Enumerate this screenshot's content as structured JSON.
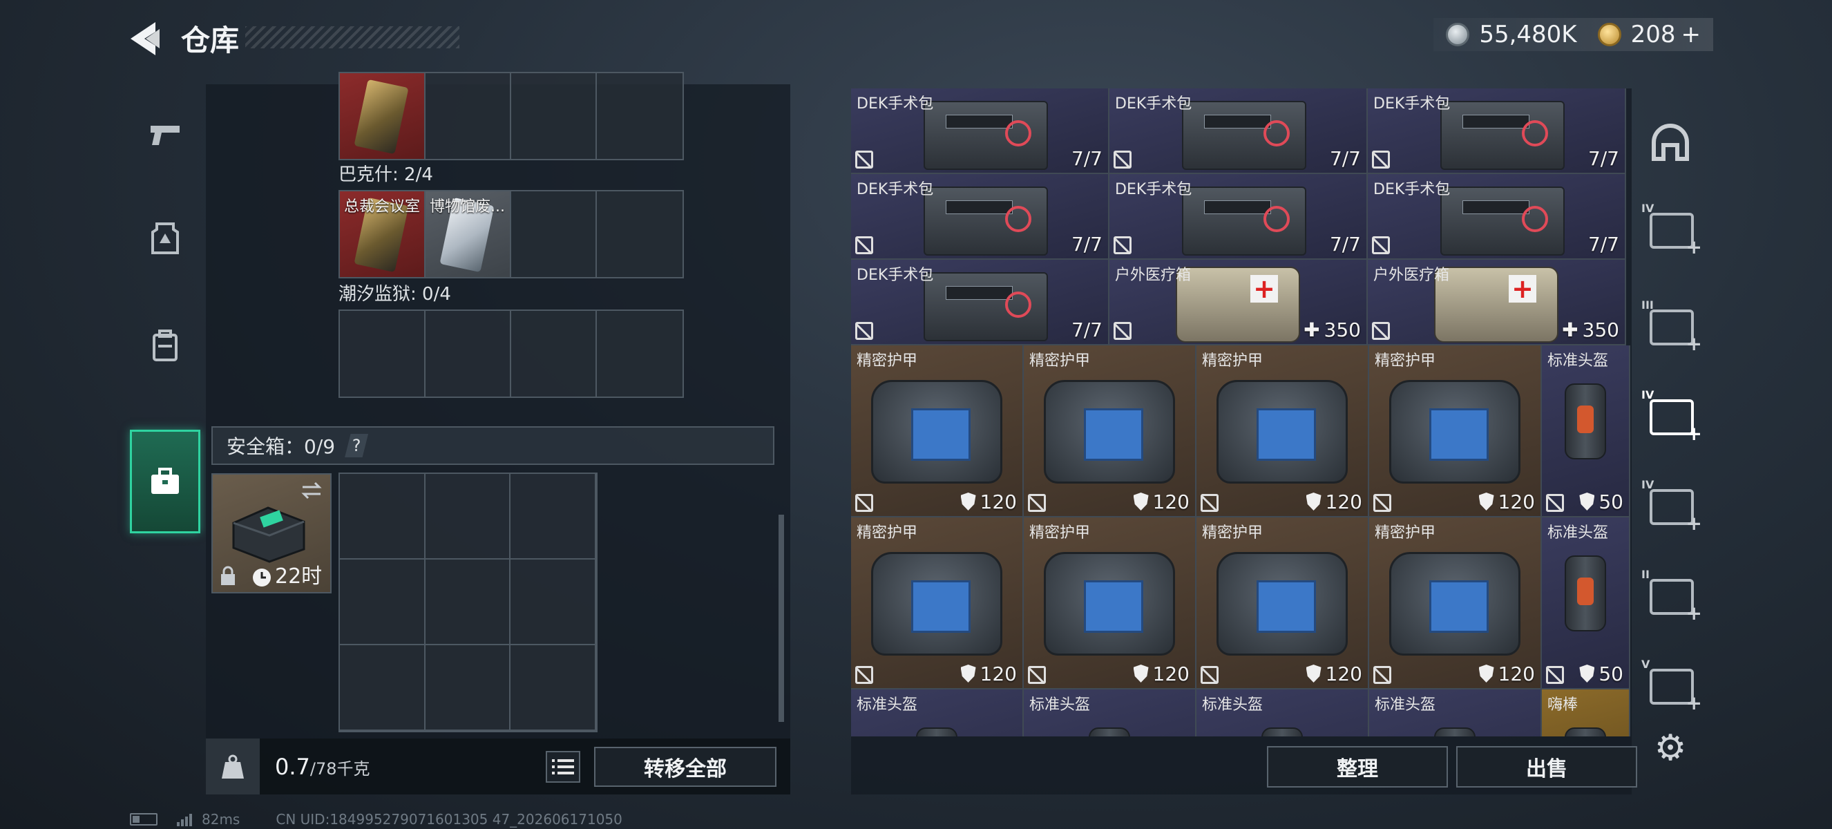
{
  "header": {
    "title": "仓库",
    "currency": {
      "silver_amount": "55,480K",
      "gold_amount": "208",
      "gold_plus": "+"
    }
  },
  "left_panel": {
    "groups": [
      {
        "label": "巴克什: 2/4"
      },
      {
        "label": "潮汐监狱: 0/4"
      }
    ],
    "top_row_cells": [
      {
        "label": "",
        "style": "red",
        "card": "gold"
      },
      {
        "label": ""
      },
      {
        "label": ""
      },
      {
        "label": ""
      }
    ],
    "bakshi_cells": [
      {
        "label": "总裁会议室",
        "style": "red",
        "card": "gold"
      },
      {
        "label": "博物馆废...",
        "style": "gray",
        "card": "silver"
      },
      {
        "label": ""
      },
      {
        "label": ""
      }
    ],
    "safebox": {
      "label": "安全箱：0/9",
      "help": "?",
      "item_timer": "22时"
    },
    "footer": {
      "weight_current": "0.7",
      "weight_max": "/78千克",
      "transfer_all": "转移全部"
    }
  },
  "right_panel": {
    "tiles": [
      {
        "name": "DEK手术包",
        "count": "7/7",
        "kind": "kit",
        "bg": "purple",
        "row": 0,
        "col": 0
      },
      {
        "name": "DEK手术包",
        "count": "7/7",
        "kind": "kit",
        "bg": "purple",
        "row": 0,
        "col": 1
      },
      {
        "name": "DEK手术包",
        "count": "7/7",
        "kind": "kit",
        "bg": "purple",
        "row": 0,
        "col": 2
      },
      {
        "name": "DEK手术包",
        "count": "7/7",
        "kind": "kit",
        "bg": "purple",
        "row": 1,
        "col": 0
      },
      {
        "name": "DEK手术包",
        "count": "7/7",
        "kind": "kit",
        "bg": "purple",
        "row": 1,
        "col": 1
      },
      {
        "name": "DEK手术包",
        "count": "7/7",
        "kind": "kit",
        "bg": "purple",
        "row": 1,
        "col": 2
      },
      {
        "name": "DEK手术包",
        "count": "7/7",
        "kind": "kit",
        "bg": "purple",
        "row": 2,
        "col": 0
      },
      {
        "name": "户外医疗箱",
        "count": "350",
        "kind": "medbox",
        "bg": "purple",
        "row": 2,
        "col": 1
      },
      {
        "name": "户外医疗箱",
        "count": "350",
        "kind": "medbox",
        "bg": "purple",
        "row": 2,
        "col": 2
      }
    ],
    "armor_tiles": [
      {
        "name": "精密护甲",
        "count": "120",
        "kind": "armor",
        "bg": "brown"
      },
      {
        "name": "精密护甲",
        "count": "120",
        "kind": "armor",
        "bg": "brown"
      },
      {
        "name": "精密护甲",
        "count": "120",
        "kind": "armor",
        "bg": "brown"
      },
      {
        "name": "精密护甲",
        "count": "120",
        "kind": "armor",
        "bg": "brown"
      },
      {
        "name": "标准头盔",
        "count": "50",
        "kind": "helmet",
        "bg": "purple"
      },
      {
        "name": "精密护甲",
        "count": "120",
        "kind": "armor",
        "bg": "brown"
      },
      {
        "name": "精密护甲",
        "count": "120",
        "kind": "armor",
        "bg": "brown"
      },
      {
        "name": "精密护甲",
        "count": "120",
        "kind": "armor",
        "bg": "brown"
      },
      {
        "name": "精密护甲",
        "count": "120",
        "kind": "armor",
        "bg": "brown"
      },
      {
        "name": "标准头盔",
        "count": "50",
        "kind": "helmet",
        "bg": "purple"
      },
      {
        "name": "标准头盔",
        "count": "",
        "kind": "helmet",
        "bg": "purple"
      },
      {
        "name": "标准头盔",
        "count": "",
        "kind": "helmet",
        "bg": "purple"
      },
      {
        "name": "标准头盔",
        "count": "",
        "kind": "helmet",
        "bg": "purple"
      },
      {
        "name": "标准头盔",
        "count": "",
        "kind": "helmet",
        "bg": "purple"
      },
      {
        "name": "嗨棒",
        "count": "",
        "kind": "other",
        "bg": "gold"
      }
    ],
    "footer": {
      "sort": "整理",
      "sell": "出售"
    }
  },
  "right_sidebar": {
    "tiers": [
      "IV",
      "III",
      "IV",
      "IV",
      "II",
      "V"
    ],
    "active_index": 2
  },
  "status_bar": {
    "ping": "82ms",
    "uid": "CN UID:184995279071601305 47_202606171050"
  }
}
